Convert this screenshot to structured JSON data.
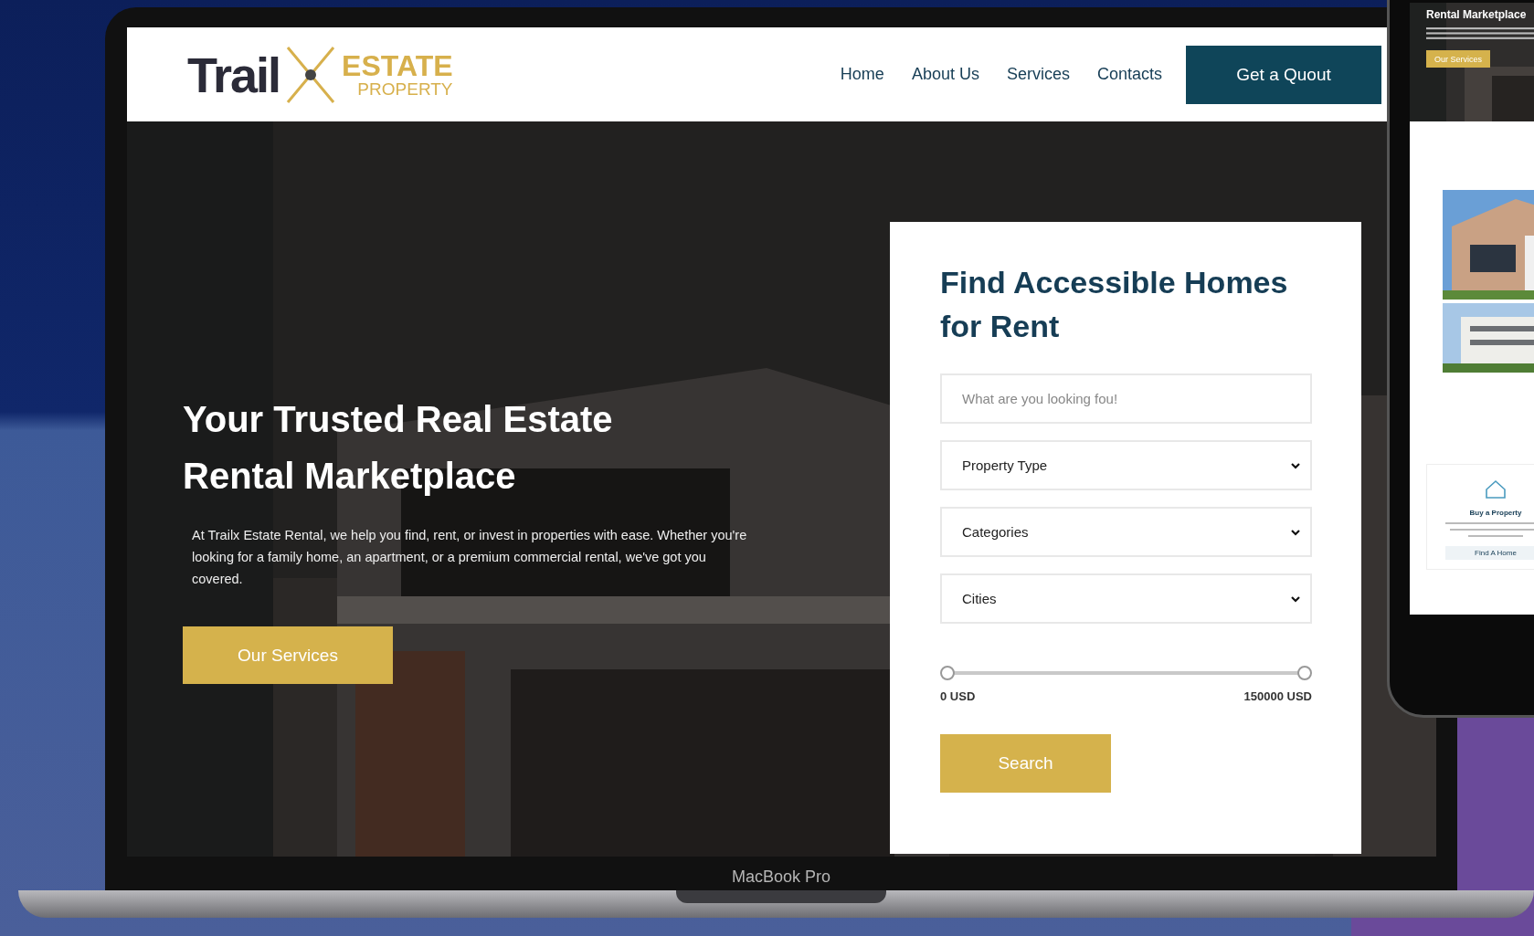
{
  "laptop": {
    "label": "MacBook Pro"
  },
  "site": {
    "logo": {
      "word": "Trail",
      "brand": "ESTATE",
      "sub": "PROPERTY"
    },
    "nav": [
      {
        "label": "Home"
      },
      {
        "label": "About Us"
      },
      {
        "label": "Services"
      },
      {
        "label": "Contacts"
      }
    ],
    "cta": "Get a Quout",
    "hero": {
      "title_lines": [
        "Your Trusted Real Estate",
        "Rental Marketplace"
      ],
      "text": "At Trailx Estate Rental, we help you find, rent, or invest in properties with ease. Whether you're looking for a family home, an apartment, or a premium commercial rental, we've got you covered.",
      "button": "Our Services"
    },
    "search_card": {
      "title_lines": [
        "Find Accessible Homes",
        "for Rent"
      ],
      "query": {
        "placeholder": "What are you looking fou!"
      },
      "selects": [
        {
          "label": "Property Type"
        },
        {
          "label": "Categories"
        },
        {
          "label": "Cities"
        }
      ],
      "price": {
        "level": 1,
        "min": "0 USD",
        "max": "150000 USD"
      },
      "button": "Search"
    }
  },
  "phone": {
    "hero_title": "Rental Marketplace",
    "hero_button": "Our Services",
    "card": {
      "title": "Buy a Property",
      "button": "Find A Home"
    }
  }
}
